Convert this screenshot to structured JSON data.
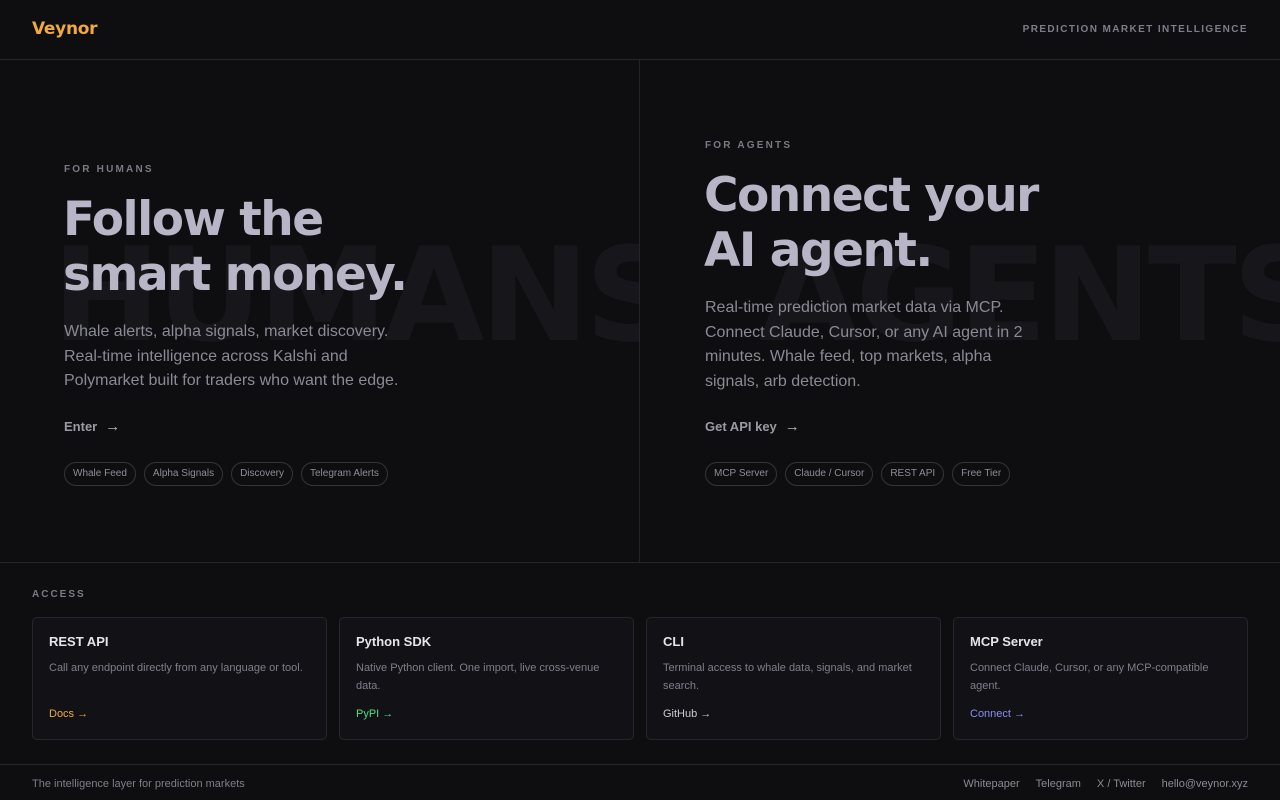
{
  "header": {
    "logo": "Veynor",
    "tagline": "PREDICTION MARKET INTELLIGENCE"
  },
  "humans": {
    "watermark": "HUMANS",
    "eyebrow": "FOR HUMANS",
    "headline_line1": "Follow the",
    "headline_line2": "smart money.",
    "desc_line1": "Whale alerts, alpha signals, market discovery.",
    "desc_line2": "Real-time intelligence across Kalshi and",
    "desc_line3": "Polymarket built for traders who want the edge.",
    "cta_label": "Enter",
    "chips": [
      "Whale Feed",
      "Alpha Signals",
      "Discovery",
      "Telegram Alerts"
    ]
  },
  "agents": {
    "watermark": "AGENTS",
    "eyebrow": "FOR AGENTS",
    "headline_line1": "Connect your",
    "headline_line2": "AI agent.",
    "desc_line1": "Real-time prediction market data via MCP.",
    "desc_line2": "Connect Claude, Cursor, or any AI agent in 2",
    "desc_line3": "minutes. Whale feed, top markets, alpha",
    "desc_line4": "signals, arb detection.",
    "cta_label": "Get API key",
    "chips": [
      "MCP Server",
      "Claude / Cursor",
      "REST API",
      "Free Tier"
    ]
  },
  "access": {
    "label": "ACCESS",
    "cards": [
      {
        "title": "REST API",
        "desc": "Call any endpoint directly from any language or tool.",
        "link": "Docs →",
        "color": "#f0a93a"
      },
      {
        "title": "Python SDK",
        "desc": "Native Python client. One import, live cross-venue data.",
        "link": "PyPI →",
        "color": "#4ade80"
      },
      {
        "title": "CLI",
        "desc": "Terminal access to whale data, signals, and market search.",
        "link": "GitHub →",
        "color": "#c9c9d1"
      },
      {
        "title": "MCP Server",
        "desc": "Connect Claude, Cursor, or any MCP-compatible agent.",
        "link": "Connect →",
        "color": "#8b8cf0"
      }
    ]
  },
  "footer": {
    "tagline": "The intelligence layer for prediction markets",
    "links": [
      "Whitepaper",
      "Telegram",
      "X / Twitter",
      "hello@veynor.xyz"
    ]
  },
  "colors": {
    "accent": "#f0a93a",
    "background": "#0e0e11"
  }
}
